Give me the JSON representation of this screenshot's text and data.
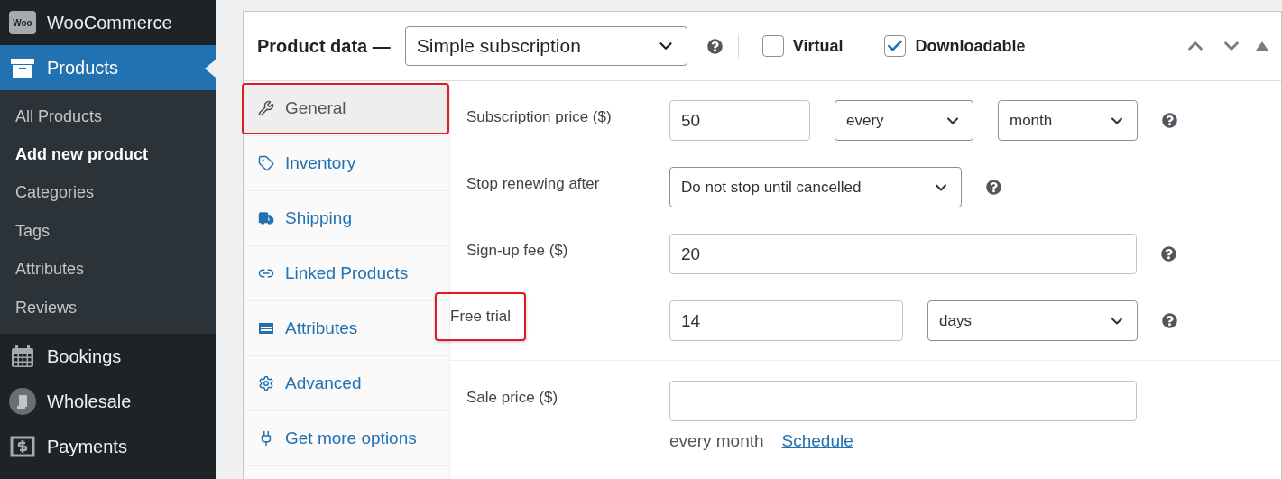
{
  "sidebar": {
    "logo_text": "Woo",
    "items": [
      {
        "label": "WooCommerce",
        "selected": false
      },
      {
        "label": "Products",
        "selected": true,
        "children": [
          {
            "label": "All Products",
            "selected": false
          },
          {
            "label": "Add new product",
            "selected": true
          },
          {
            "label": "Categories",
            "selected": false
          },
          {
            "label": "Tags",
            "selected": false
          },
          {
            "label": "Attributes",
            "selected": false
          },
          {
            "label": "Reviews",
            "selected": false
          }
        ]
      },
      {
        "label": "Bookings",
        "selected": false
      },
      {
        "label": "Wholesale",
        "selected": false
      },
      {
        "label": "Payments",
        "selected": false
      }
    ]
  },
  "product_data": {
    "title": "Product data —",
    "type_select": "Simple subscription",
    "checkboxes": [
      {
        "label": "Virtual",
        "checked": false
      },
      {
        "label": "Downloadable",
        "checked": true
      }
    ],
    "tabs": [
      {
        "label": "General",
        "selected": true,
        "highlighted": true
      },
      {
        "label": "Inventory",
        "selected": false,
        "highlighted": false
      },
      {
        "label": "Shipping",
        "selected": false,
        "highlighted": false
      },
      {
        "label": "Linked Products",
        "selected": false,
        "highlighted": false
      },
      {
        "label": "Attributes",
        "selected": false,
        "highlighted": false
      },
      {
        "label": "Advanced",
        "selected": false,
        "highlighted": false
      },
      {
        "label": "Get more options",
        "selected": false,
        "highlighted": false
      }
    ],
    "fields": [
      {
        "label": "Subscription price ($)",
        "highlighted": false,
        "help": true,
        "controls": [
          {
            "kind": "input",
            "value": "50"
          },
          {
            "kind": "select",
            "value": "every"
          },
          {
            "kind": "select",
            "value": "month"
          }
        ]
      },
      {
        "label": "Stop renewing after",
        "highlighted": false,
        "help": true,
        "controls": [
          {
            "kind": "select",
            "value": "Do not stop until cancelled"
          }
        ]
      },
      {
        "label": "Sign-up fee ($)",
        "highlighted": false,
        "help": true,
        "controls": [
          {
            "kind": "input",
            "value": "20"
          }
        ]
      },
      {
        "label": "Free trial",
        "highlighted": true,
        "help": true,
        "controls": [
          {
            "kind": "input",
            "value": "14"
          },
          {
            "kind": "select",
            "value": "days"
          }
        ]
      }
    ],
    "sale": {
      "label": "Sale price ($)",
      "note": "every month",
      "link": "Schedule"
    }
  }
}
